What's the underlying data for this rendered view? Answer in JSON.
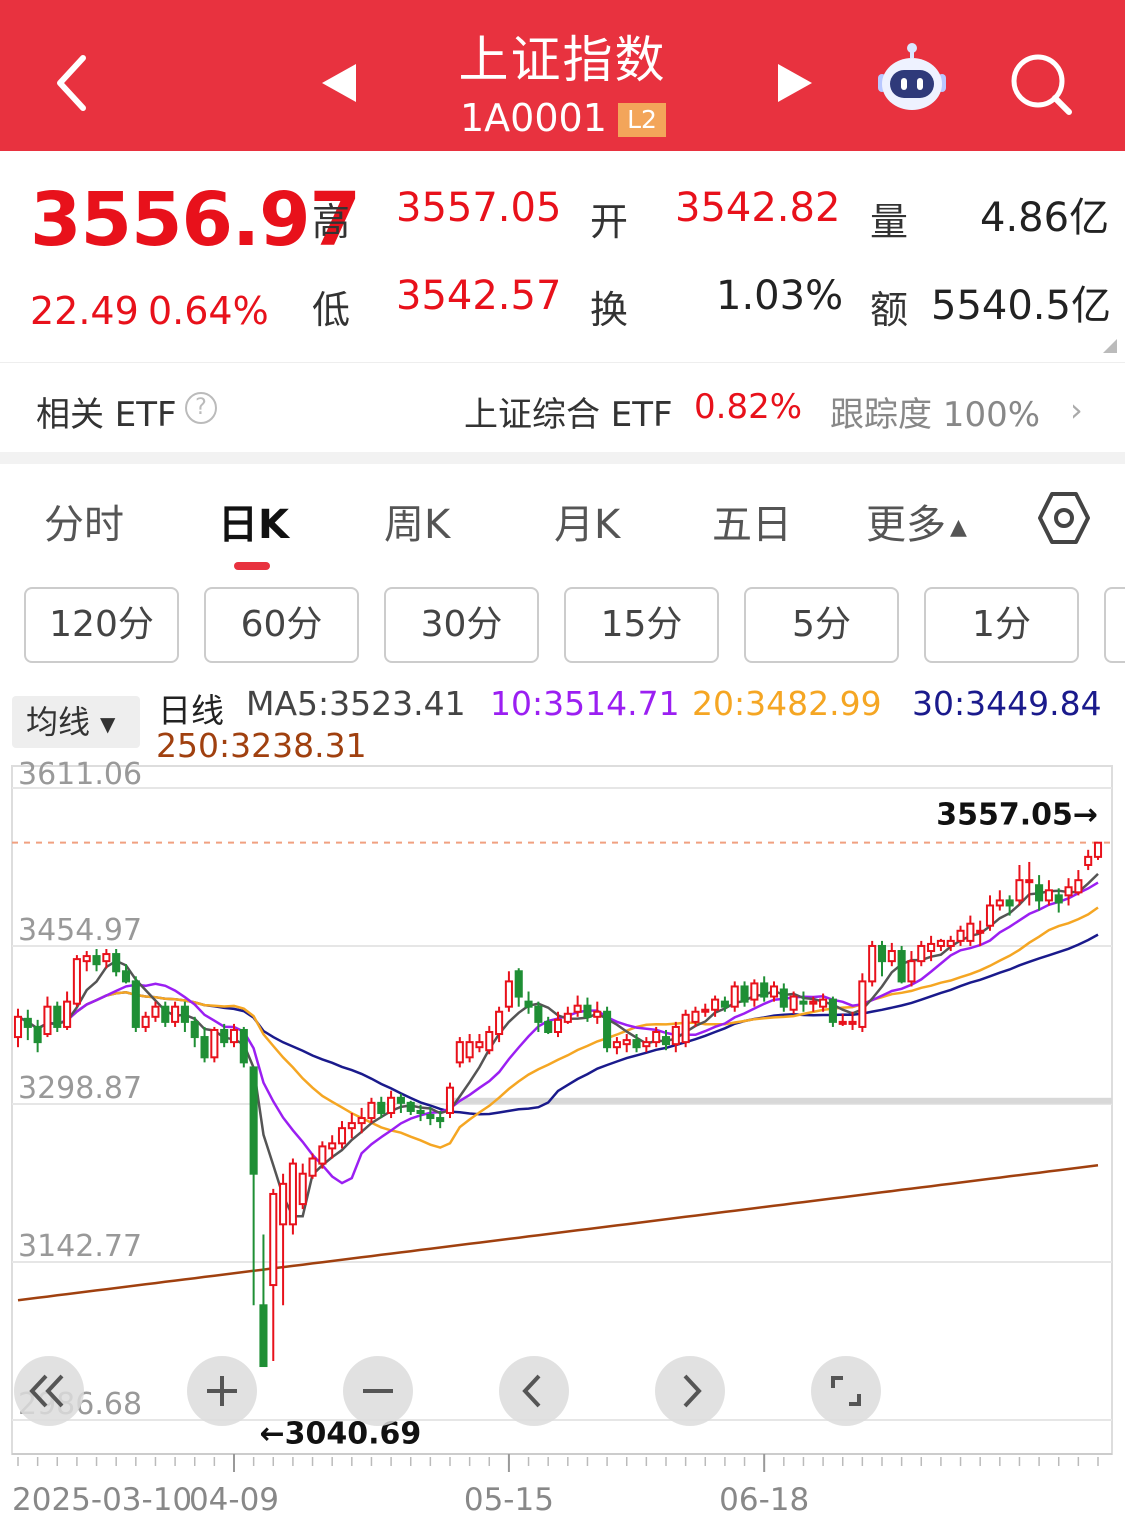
{
  "header": {
    "title": "上证指数",
    "code": "1A0001",
    "level": "L2"
  },
  "quote": {
    "price": "3556.97",
    "change": "22.49",
    "change_pct": "0.64%",
    "high_label": "高",
    "high": "3557.05",
    "low_label": "低",
    "low": "3542.57",
    "open_label": "开",
    "open": "3542.82",
    "turnover_label": "换",
    "turnover": "1.03%",
    "volume_label": "量",
    "volume": "4.86亿",
    "amount_label": "额",
    "amount": "5540.5亿"
  },
  "etf": {
    "label": "相关 ETF",
    "help": "?",
    "name": "上证综合 ETF",
    "change": "0.82%",
    "tracking": "跟踪度  100%"
  },
  "tabs": [
    "分时",
    "日K",
    "周K",
    "月K",
    "五日",
    "更多"
  ],
  "periods": [
    "120分",
    "60分",
    "30分",
    "15分",
    "5分",
    "1分"
  ],
  "ma_bar": {
    "selector": "均线",
    "line_type": "日线",
    "ma5": "MA5:3523.41",
    "ma10": "10:3514.71",
    "ma20": "20:3482.99",
    "ma30": "30:3449.84",
    "ma250": "250:3238.31"
  },
  "colors": {
    "header": "#e8323f",
    "up": "#e8111b",
    "down": "#1f8f35",
    "ma5": "#555555",
    "ma10": "#9b1ff2",
    "ma20": "#f5a623",
    "ma30": "#1a1a8c",
    "ma250": "#a0400f"
  },
  "chart_data": {
    "type": "candlestick",
    "y_ticks": [
      "3611.06",
      "3454.97",
      "3298.87",
      "3142.77",
      "2986.68"
    ],
    "ylim": [
      2986.68,
      3611.06
    ],
    "x_ticks": [
      "2025-03-10",
      "04-09",
      "05-15",
      "06-18"
    ],
    "high_marker": "3557.05→",
    "low_marker": "←3040.69",
    "candles": [
      [
        3365,
        3385,
        3355,
        3393
      ],
      [
        3383,
        3375,
        3362,
        3392
      ],
      [
        3375,
        3360,
        3350,
        3382
      ],
      [
        3368,
        3395,
        3365,
        3405
      ],
      [
        3395,
        3375,
        3370,
        3400
      ],
      [
        3375,
        3400,
        3372,
        3410
      ],
      [
        3398,
        3442,
        3395,
        3446
      ],
      [
        3440,
        3445,
        3430,
        3450
      ],
      [
        3445,
        3437,
        3430,
        3452
      ],
      [
        3440,
        3447,
        3433,
        3452
      ],
      [
        3447,
        3430,
        3425,
        3452
      ],
      [
        3430,
        3420,
        3418,
        3437
      ],
      [
        3420,
        3375,
        3370,
        3425
      ],
      [
        3375,
        3385,
        3370,
        3390
      ],
      [
        3385,
        3395,
        3380,
        3400
      ],
      [
        3395,
        3380,
        3375,
        3400
      ],
      [
        3380,
        3395,
        3375,
        3400
      ],
      [
        3395,
        3380,
        3370,
        3400
      ],
      [
        3380,
        3365,
        3355,
        3385
      ],
      [
        3365,
        3345,
        3340,
        3375
      ],
      [
        3345,
        3372,
        3340,
        3375
      ],
      [
        3372,
        3360,
        3355,
        3378
      ],
      [
        3360,
        3372,
        3355,
        3378
      ],
      [
        3372,
        3340,
        3335,
        3375
      ],
      [
        3335,
        3230,
        3100,
        3240
      ],
      [
        3100,
        3040,
        3041,
        3170
      ],
      [
        3120,
        3210,
        3045,
        3215
      ],
      [
        3180,
        3220,
        3100,
        3230
      ],
      [
        3180,
        3240,
        3170,
        3245
      ],
      [
        3200,
        3230,
        3195,
        3240
      ],
      [
        3228,
        3245,
        3225,
        3250
      ],
      [
        3240,
        3257,
        3235,
        3262
      ],
      [
        3255,
        3260,
        3245,
        3268
      ],
      [
        3260,
        3275,
        3255,
        3282
      ],
      [
        3275,
        3280,
        3265,
        3290
      ],
      [
        3280,
        3285,
        3270,
        3295
      ],
      [
        3285,
        3300,
        3280,
        3305
      ],
      [
        3300,
        3290,
        3285,
        3306
      ],
      [
        3290,
        3305,
        3285,
        3312
      ],
      [
        3305,
        3300,
        3290,
        3309
      ],
      [
        3300,
        3292,
        3288,
        3302
      ],
      [
        3292,
        3290,
        3282,
        3298
      ],
      [
        3288,
        3285,
        3278,
        3296
      ],
      [
        3285,
        3282,
        3275,
        3292
      ],
      [
        3290,
        3315,
        3285,
        3320
      ],
      [
        3340,
        3360,
        3335,
        3365
      ],
      [
        3345,
        3360,
        3340,
        3368
      ],
      [
        3355,
        3360,
        3350,
        3368
      ],
      [
        3352,
        3370,
        3348,
        3376
      ],
      [
        3368,
        3390,
        3360,
        3395
      ],
      [
        3395,
        3420,
        3390,
        3430
      ],
      [
        3430,
        3405,
        3395,
        3433
      ],
      [
        3400,
        3395,
        3388,
        3410
      ],
      [
        3395,
        3380,
        3370,
        3400
      ],
      [
        3380,
        3370,
        3368,
        3385
      ],
      [
        3370,
        3382,
        3365,
        3390
      ],
      [
        3380,
        3388,
        3378,
        3395
      ],
      [
        3390,
        3396,
        3385,
        3406
      ],
      [
        3396,
        3385,
        3380,
        3404
      ],
      [
        3385,
        3390,
        3378,
        3400
      ],
      [
        3390,
        3355,
        3350,
        3395
      ],
      [
        3355,
        3360,
        3348,
        3365
      ],
      [
        3358,
        3362,
        3350,
        3368
      ],
      [
        3362,
        3355,
        3350,
        3368
      ],
      [
        3356,
        3360,
        3350,
        3365
      ],
      [
        3360,
        3370,
        3355,
        3375
      ],
      [
        3365,
        3358,
        3352,
        3372
      ],
      [
        3358,
        3375,
        3350,
        3380
      ],
      [
        3360,
        3387,
        3355,
        3392
      ],
      [
        3380,
        3390,
        3375,
        3395
      ],
      [
        3390,
        3392,
        3385,
        3398
      ],
      [
        3392,
        3402,
        3385,
        3406
      ],
      [
        3400,
        3395,
        3390,
        3405
      ],
      [
        3395,
        3415,
        3390,
        3420
      ],
      [
        3415,
        3400,
        3395,
        3420
      ],
      [
        3402,
        3418,
        3395,
        3422
      ],
      [
        3418,
        3405,
        3400,
        3425
      ],
      [
        3405,
        3415,
        3400,
        3420
      ],
      [
        3412,
        3395,
        3390,
        3418
      ],
      [
        3392,
        3405,
        3388,
        3410
      ],
      [
        3400,
        3398,
        3390,
        3410
      ],
      [
        3398,
        3400,
        3390,
        3405
      ],
      [
        3395,
        3402,
        3390,
        3408
      ],
      [
        3402,
        3380,
        3375,
        3405
      ],
      [
        3380,
        3380,
        3376,
        3388
      ],
      [
        3378,
        3380,
        3372,
        3390
      ],
      [
        3375,
        3420,
        3370,
        3428
      ],
      [
        3420,
        3455,
        3415,
        3460
      ],
      [
        3455,
        3440,
        3425,
        3460
      ],
      [
        3440,
        3450,
        3435,
        3458
      ],
      [
        3450,
        3420,
        3418,
        3455
      ],
      [
        3420,
        3440,
        3415,
        3450
      ],
      [
        3440,
        3455,
        3435,
        3460
      ],
      [
        3450,
        3457,
        3440,
        3465
      ],
      [
        3455,
        3460,
        3450,
        3462
      ],
      [
        3455,
        3460,
        3450,
        3465
      ],
      [
        3460,
        3470,
        3455,
        3475
      ],
      [
        3460,
        3477,
        3455,
        3485
      ],
      [
        3470,
        3470,
        3455,
        3480
      ],
      [
        3475,
        3495,
        3470,
        3505
      ],
      [
        3495,
        3500,
        3490,
        3510
      ],
      [
        3500,
        3495,
        3485,
        3505
      ],
      [
        3500,
        3520,
        3495,
        3535
      ],
      [
        3520,
        3520,
        3495,
        3538
      ],
      [
        3515,
        3500,
        3490,
        3525
      ],
      [
        3500,
        3510,
        3495,
        3520
      ],
      [
        3505,
        3498,
        3488,
        3512
      ],
      [
        3505,
        3513,
        3495,
        3522
      ],
      [
        3508,
        3520,
        3505,
        3530
      ],
      [
        3535,
        3543,
        3530,
        3550
      ],
      [
        3543,
        3557,
        3540,
        3557
      ]
    ]
  }
}
